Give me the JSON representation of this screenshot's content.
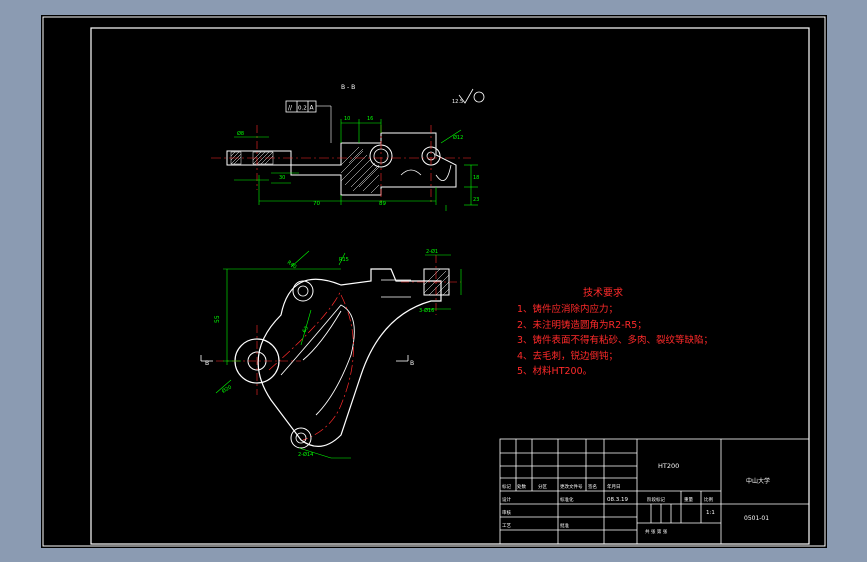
{
  "section_label": "B - B",
  "tolerance_frame": {
    "symbol": "//",
    "value": "0.2",
    "datum": "A"
  },
  "roughness_symbol": "12.5",
  "dims_top": {
    "d10": "10",
    "d16": "16",
    "d30": "30",
    "d70": "70",
    "d89": "89",
    "d18": "18",
    "d23": "23",
    "d12": "Ø12",
    "phi8": "Ø8"
  },
  "dims_front": {
    "d55": "55",
    "r40": "R40",
    "r15": "R15",
    "holes_top": "2-Ø1",
    "holes_mid": "3-Ø16",
    "holes_bottom": "2-Ø14",
    "phi20": "Ø20",
    "d63": "63"
  },
  "section_marks": {
    "left": "B",
    "right": "B"
  },
  "tech_requirements": {
    "title": "技术要求",
    "items": [
      "1、铸件应消除内应力；",
      "2、未注明铸造圆角为R2-R5；",
      "3、铸件表面不得有粘砂、多肉、裂纹等缺陷；",
      "4、去毛刺，锐边倒钝；",
      "5、材料HT200。"
    ]
  },
  "title_block": {
    "material": "HT200",
    "company": "中山大学",
    "drawing_no": "0501-01",
    "scale": "1:1",
    "date": "08.3.19",
    "labels": {
      "mark": "标记",
      "count": "处数",
      "zone": "分区",
      "change_doc": "更改文件号",
      "sign": "签名",
      "ymd": "年月日",
      "design": "设计",
      "std": "标准化",
      "review": "审核",
      "process": "工艺",
      "approve": "批准",
      "stage_mark": "阶段标记",
      "weight": "重量",
      "ratio": "比例",
      "total": "共 张  第 张"
    }
  },
  "colors": {
    "background": "#000000",
    "frame": "#ffffff",
    "geometry": "#ffffff",
    "dimension": "#00ff00",
    "center_line": "#ff2a2a",
    "hatch": "#ffffff",
    "title_block_text": "#ffffff",
    "requirements": "#ff2a2a"
  }
}
